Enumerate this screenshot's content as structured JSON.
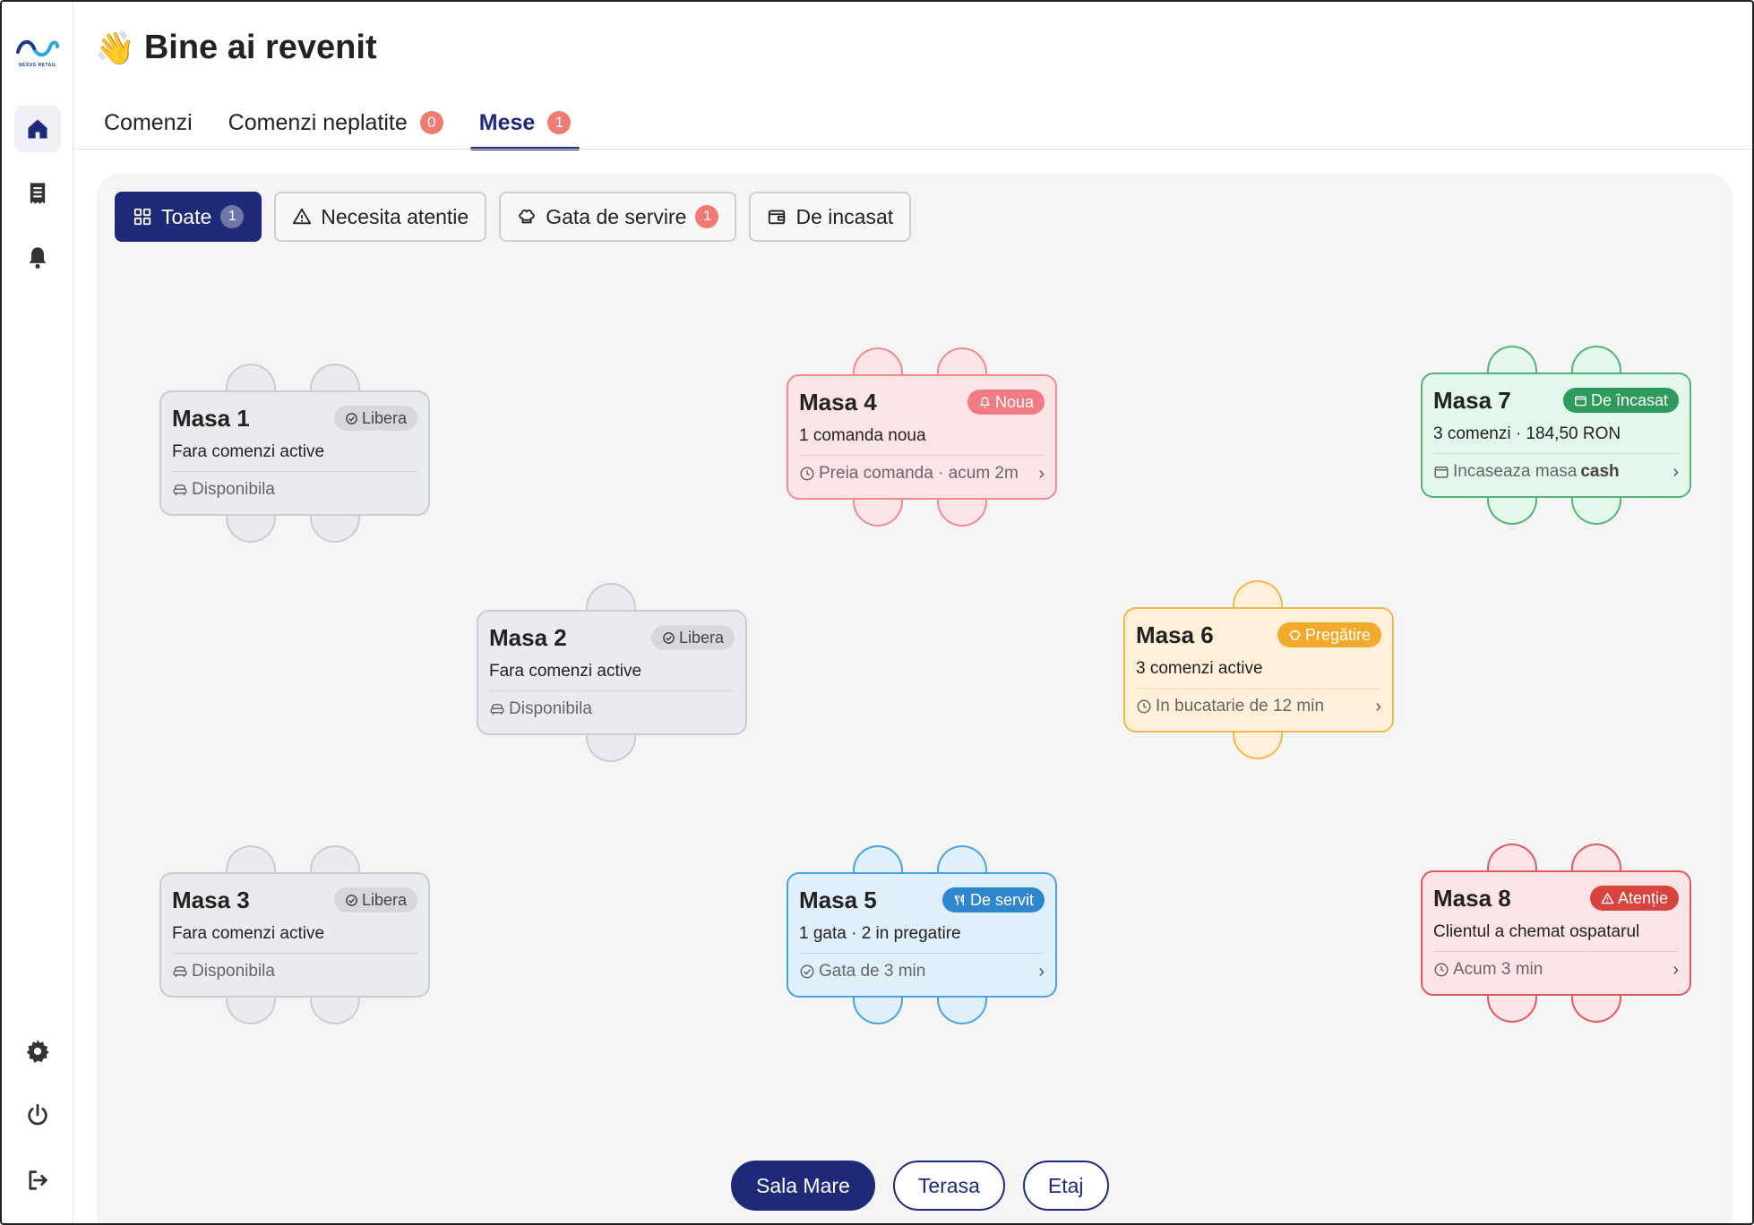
{
  "app": {
    "logo_text": "NEXUS RETAIL",
    "greeting_emoji": "👋",
    "title": "Bine ai revenit"
  },
  "sidebar": {
    "items": [
      {
        "icon": "home-icon",
        "active": true
      },
      {
        "icon": "receipt-icon",
        "active": false
      },
      {
        "icon": "bell-icon",
        "active": false
      },
      {
        "icon": "gear-icon",
        "active": false
      },
      {
        "icon": "power-icon",
        "active": false
      },
      {
        "icon": "logout-icon",
        "active": false
      }
    ]
  },
  "tabs": [
    {
      "label": "Comenzi",
      "badge": null,
      "active": false
    },
    {
      "label": "Comenzi neplatite",
      "badge": "0",
      "active": false
    },
    {
      "label": "Mese",
      "badge": "1",
      "active": true
    }
  ],
  "filters": [
    {
      "label": "Toate",
      "badge": "1",
      "icon": "grid-icon",
      "active": true
    },
    {
      "label": "Necesita atentie",
      "badge": null,
      "icon": "warning-icon",
      "active": false
    },
    {
      "label": "Gata de servire",
      "badge": "1",
      "icon": "chef-hat-icon",
      "active": false
    },
    {
      "label": "De incasat",
      "badge": null,
      "icon": "wallet-icon",
      "active": false
    }
  ],
  "tables": [
    {
      "name": "Masa 1",
      "status": "Libera",
      "subtitle": "Fara comenzi active",
      "footer": "Disponibila",
      "theme": "gray"
    },
    {
      "name": "Masa 2",
      "status": "Libera",
      "subtitle": "Fara comenzi active",
      "footer": "Disponibila",
      "theme": "gray"
    },
    {
      "name": "Masa 3",
      "status": "Libera",
      "subtitle": "Fara comenzi active",
      "footer": "Disponibila",
      "theme": "gray"
    },
    {
      "name": "Masa 4",
      "status": "Noua",
      "subtitle": "1 comanda noua",
      "footer": "Preia comanda · acum 2m",
      "theme": "red"
    },
    {
      "name": "Masa 5",
      "status": "De servit",
      "subtitle": "1 gata · 2 in pregatire",
      "footer": "Gata de 3 min",
      "theme": "blue"
    },
    {
      "name": "Masa 6",
      "status": "Pregătire",
      "subtitle": "3 comenzi active",
      "footer": "In bucatarie de 12 min",
      "theme": "orange"
    },
    {
      "name": "Masa 7",
      "status": "De încasat",
      "subtitle": "3 comenzi · 184,50 RON",
      "footer_prefix": "Incaseaza masa",
      "footer_bold": "cash",
      "theme": "green"
    },
    {
      "name": "Masa 8",
      "status": "Atenție",
      "subtitle": "Clientul a chemat ospatarul",
      "footer": "Acum 3 min",
      "theme": "alert"
    }
  ],
  "rooms": [
    {
      "label": "Sala Mare",
      "active": true
    },
    {
      "label": "Terasa",
      "active": false
    },
    {
      "label": "Etaj",
      "active": false
    }
  ],
  "colors": {
    "primary": "#1e2a78",
    "badge": "#f07b72",
    "free": "#e9ebee",
    "new": "#f07b82",
    "ready": "#2f86cc",
    "preparing": "#f2a92c",
    "pay": "#2e9a5e",
    "alert": "#d9443f"
  }
}
